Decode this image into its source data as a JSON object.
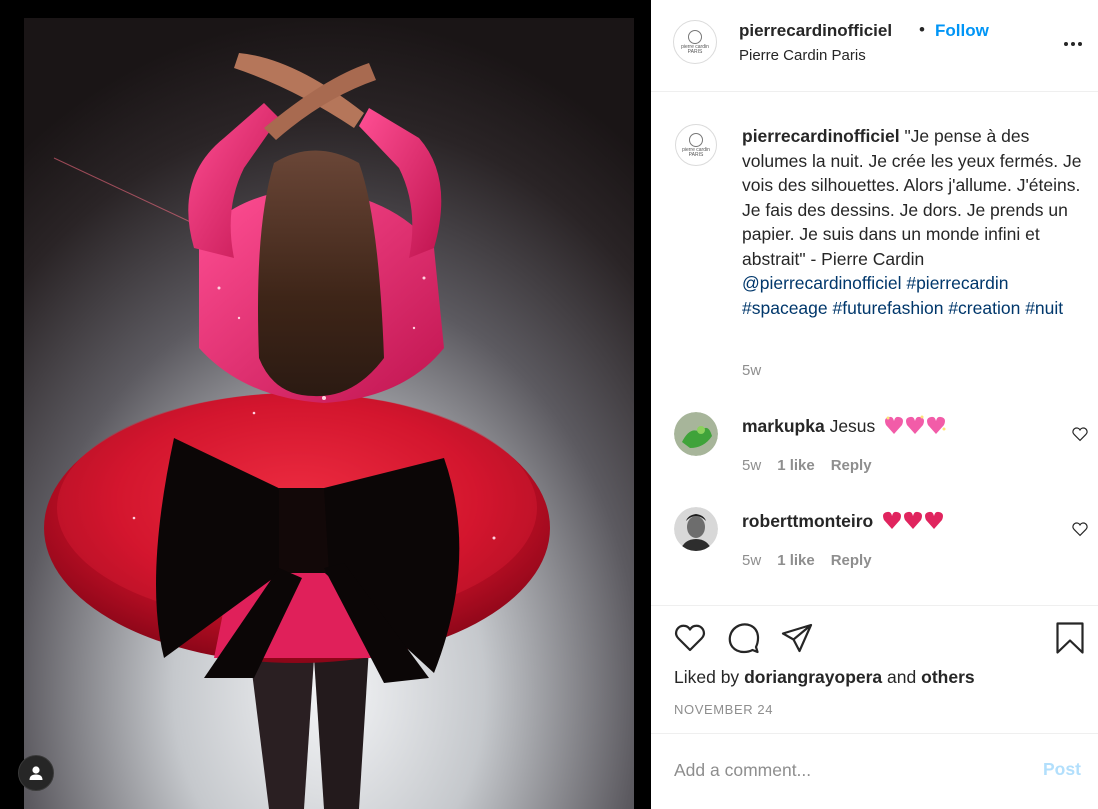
{
  "post": {
    "username": "pierrecardinofficiel",
    "separator": "•",
    "follow_label": "Follow",
    "location": "Pierre Cardin Paris",
    "avatar_brand_text": "pierre cardin",
    "avatar_brand_subtext": "PARIS",
    "more_icon": "more-options-icon"
  },
  "caption": {
    "username": "pierrecardinofficiel",
    "text": "\"Je pense à des volumes la nuit. Je crée les yeux fermés. Je vois des silhouettes. Alors j'allume. J'éteins. Je fais des dessins. Je dors. Je prends un papier. Je suis dans un monde infini et abstrait\" - Pierre Cardin",
    "mention": "@pierrecardinofficiel",
    "hashtags": [
      "#pierrecardin",
      "#spaceage",
      "#futurefashion",
      "#creation",
      "#nuit"
    ],
    "time": "5w"
  },
  "comments": [
    {
      "username": "markupka",
      "text": "Jesus",
      "emoji": "three sparkling pink hearts",
      "heart_color": "#f25ca8",
      "time": "5w",
      "likes": "1 like",
      "reply_label": "Reply"
    },
    {
      "username": "roberttmonteiro",
      "text": "",
      "emoji": "three red hearts",
      "heart_color": "#e0245e",
      "time": "5w",
      "likes": "1 like",
      "reply_label": "Reply"
    }
  ],
  "actions": {
    "icons": [
      "heart-icon",
      "comment-icon",
      "share-icon",
      "bookmark-icon"
    ],
    "liked_by_prefix": "Liked by",
    "liked_by_user": "doriangrayopera",
    "liked_by_and": "and",
    "liked_by_others": "others",
    "date": "NOVEMBER 24"
  },
  "add_comment": {
    "placeholder": "Add a comment...",
    "post_label": "Post"
  },
  "colors": {
    "link": "#00376b",
    "follow": "#0095f6",
    "post_disabled": "#b2dffc",
    "muted": "#8e8e8e"
  }
}
